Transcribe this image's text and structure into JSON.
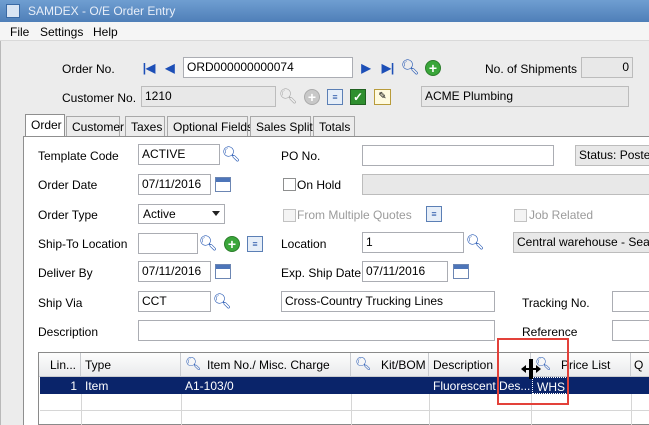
{
  "window": {
    "title": "SAMDEX - O/E Order Entry",
    "icon_name": "app-icon"
  },
  "menu": [
    {
      "label": "File"
    },
    {
      "label": "Settings"
    },
    {
      "label": "Help"
    }
  ],
  "header": {
    "order_no_label": "Order No.",
    "order_no_value": "ORD000000000074",
    "customer_no_label": "Customer No.",
    "customer_no_value": "1210",
    "customer_name": "ACME Plumbing",
    "shipments_label": "No. of Shipments",
    "shipments_value": "0"
  },
  "tabs": [
    {
      "label": "Order",
      "active": true
    },
    {
      "label": "Customer"
    },
    {
      "label": "Taxes"
    },
    {
      "label": "Optional Fields"
    },
    {
      "label": "Sales Split"
    },
    {
      "label": "Totals"
    }
  ],
  "order_tab": {
    "template_code_label": "Template Code",
    "template_code_value": "ACTIVE",
    "po_no_label": "PO No.",
    "po_no_value": "",
    "status_text": "Status: Posted",
    "order_date_label": "Order Date",
    "order_date_value": "07/11/2016",
    "on_hold_label": "On Hold",
    "order_type_label": "Order Type",
    "order_type_value": "Active",
    "from_quotes_label": "From Multiple Quotes",
    "job_related_label": "Job Related",
    "ship_to_label": "Ship-To Location",
    "ship_to_value": "",
    "location_label": "Location",
    "location_value": "1",
    "location_desc": "Central warehouse - Seattle",
    "deliver_by_label": "Deliver By",
    "deliver_by_value": "07/11/2016",
    "exp_ship_label": "Exp. Ship Date",
    "exp_ship_value": "07/11/2016",
    "ship_via_label": "Ship Via",
    "ship_via_value": "CCT",
    "ship_via_desc": "Cross-Country Trucking Lines",
    "tracking_label": "Tracking No.",
    "description_label": "Description",
    "reference_label": "Reference"
  },
  "grid": {
    "columns": [
      "Lin...",
      "Type",
      "Item No./ Misc. Charge",
      "Kit/BOM",
      "Description",
      "Price List",
      "Q"
    ],
    "rows": [
      {
        "line": "1",
        "type": "Item",
        "item_no": "A1-103/0",
        "kit": "",
        "description": "Fluorescent Des...",
        "price_list": "WHS"
      }
    ]
  },
  "colors": {
    "title_bar": "#4f7fb8",
    "selected_row": "#0a246a",
    "highlight_box": "#e3413a",
    "add_button": "#3aa63a"
  }
}
